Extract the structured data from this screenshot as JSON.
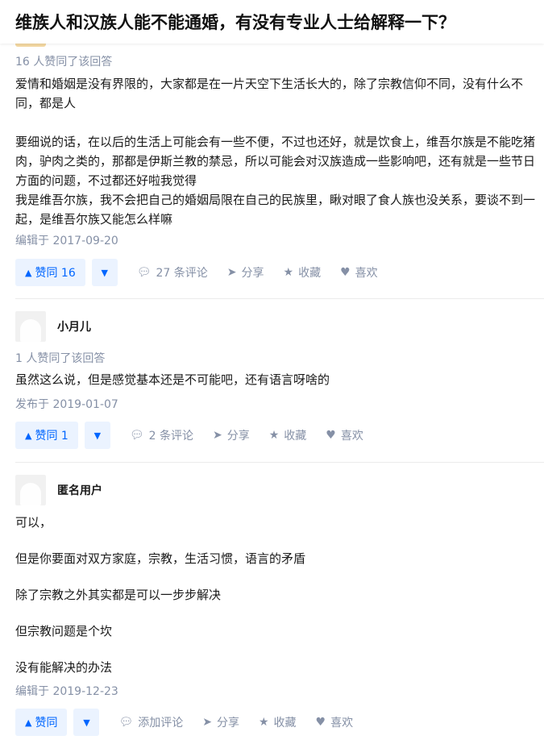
{
  "question": {
    "title": "维族人和汉族人能不能通婚，有没有专业人士给解释一下？"
  },
  "answers": [
    {
      "votes_text": "16 人赞同了该回答",
      "paragraphs": [
        "爱情和婚姻是没有界限的，大家都是在一片天空下生活长大的，除了宗教信仰不同，没有什么不同，都是人",
        "",
        "要细说的话，在以后的生活上可能会有一些不便，不过也还好，就是饮食上，维吾尔族是不能吃猪肉，驴肉之类的，那都是伊斯兰教的禁忌，所以可能会对汉族造成一些影响吧，还有就是一些节日方面的问题，不过都还好啦我觉得",
        "我是维吾尔族，我不会把自己的婚姻局限在自己的民族里，瞅对眼了食人族也没关系，要谈不到一起，是维吾尔族又能怎么样嘛"
      ],
      "time": "编辑于 2017-09-20",
      "vote_label": "赞同 16",
      "comments_label": "27 条评论",
      "share_label": "分享",
      "collect_label": "收藏",
      "like_label": "喜欢"
    },
    {
      "author": "小月儿",
      "votes_text": "1 人赞同了该回答",
      "paragraphs": [
        "虽然这么说，但是感觉基本还是不可能吧，还有语言呀啥的"
      ],
      "time": "发布于 2019-01-07",
      "vote_label": "赞同 1",
      "comments_label": "2 条评论",
      "share_label": "分享",
      "collect_label": "收藏",
      "like_label": "喜欢"
    },
    {
      "author": "匿名用户",
      "paragraphs": [
        "可以，",
        "",
        "但是你要面对双方家庭，宗教，生活习惯，语言的矛盾",
        "",
        "除了宗教之外其实都是可以一步步解决",
        "",
        "但宗教问题是个坎",
        "",
        "没有能解决的办法"
      ],
      "time": "编辑于 2019-12-23",
      "vote_label": "赞同",
      "comments_label": "添加评论",
      "share_label": "分享",
      "collect_label": "收藏",
      "like_label": "喜欢"
    }
  ],
  "icons": {
    "vote_up": "triangle-up-icon",
    "vote_down": "triangle-down-icon",
    "comment": "comment-bubble-icon",
    "share": "paper-plane-icon",
    "collect": "star-icon",
    "like": "heart-icon"
  },
  "colors": {
    "accent": "#0066ff",
    "accent_bg": "#ebf3ff",
    "meta_gray": "#8590a6"
  }
}
